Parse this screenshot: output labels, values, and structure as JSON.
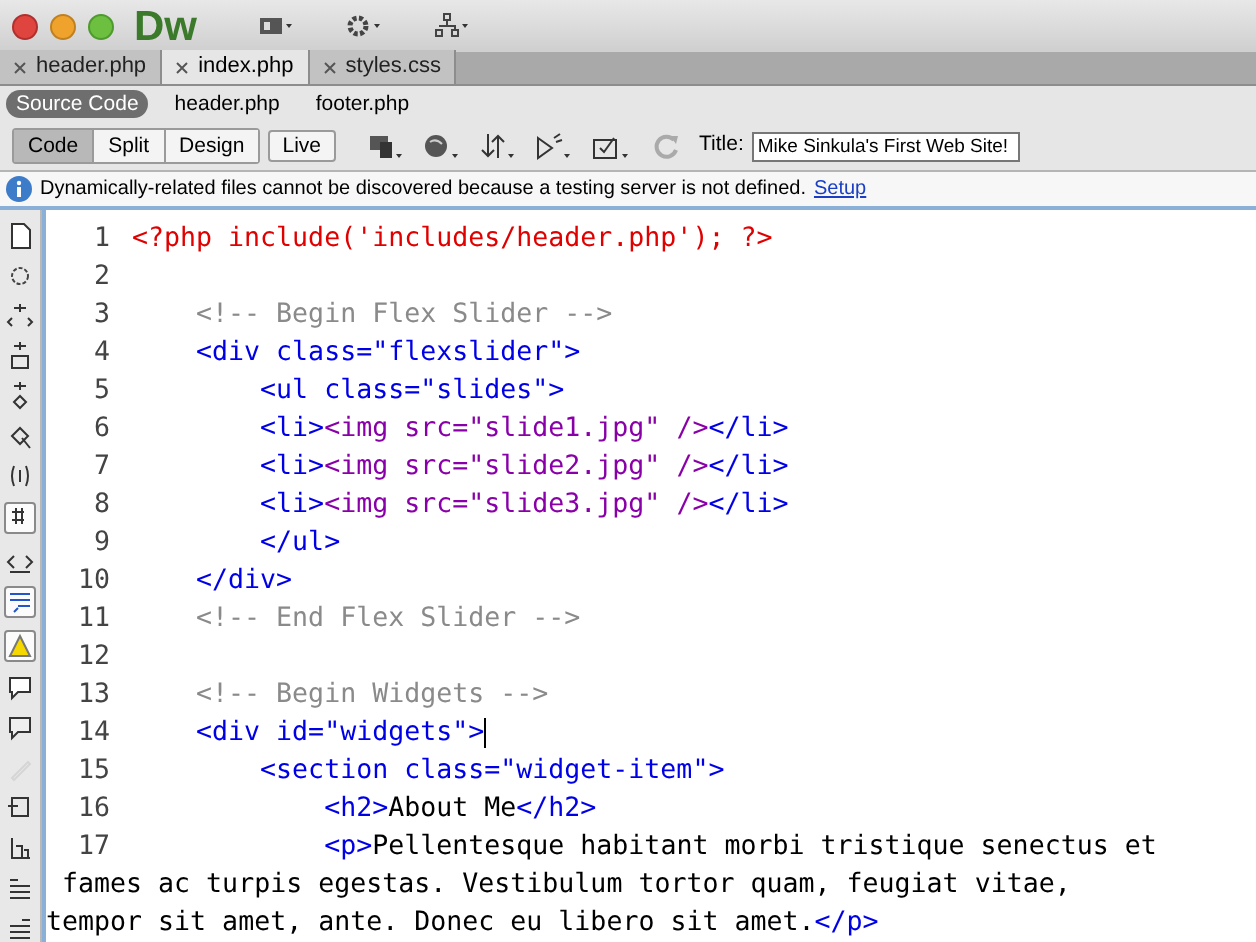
{
  "app": {
    "logo": "Dw"
  },
  "tabs": [
    {
      "label": "header.php",
      "selected": false
    },
    {
      "label": "index.php",
      "selected": true
    },
    {
      "label": "styles.css",
      "selected": false
    }
  ],
  "related_files": [
    {
      "label": "Source Code",
      "selected": true
    },
    {
      "label": "header.php",
      "selected": false
    },
    {
      "label": "footer.php",
      "selected": false
    }
  ],
  "view_buttons": [
    {
      "label": "Code",
      "selected": true
    },
    {
      "label": "Split",
      "selected": false
    },
    {
      "label": "Design",
      "selected": false
    }
  ],
  "live_button": {
    "label": "Live",
    "selected": false
  },
  "title_field": {
    "label": "Title:",
    "value": "Mike Sinkula's First Web Site!"
  },
  "info_bar": {
    "message": "Dynamically-related files cannot be discovered because a testing server is not defined.",
    "link": "Setup"
  },
  "side_tools": [
    {
      "on": false,
      "disabled": false
    },
    {
      "on": false,
      "disabled": false
    },
    {
      "on": false,
      "disabled": false
    },
    {
      "on": false,
      "disabled": false
    },
    {
      "on": false,
      "disabled": false
    },
    {
      "on": false,
      "disabled": false
    },
    {
      "on": false,
      "disabled": false
    },
    {
      "on": true,
      "disabled": false
    },
    {
      "on": false,
      "disabled": false
    },
    {
      "on": true,
      "disabled": false
    },
    {
      "on": true,
      "disabled": false
    },
    {
      "on": false,
      "disabled": false
    },
    {
      "on": false,
      "disabled": false
    },
    {
      "on": false,
      "disabled": true
    },
    {
      "on": false,
      "disabled": false
    },
    {
      "on": false,
      "disabled": false
    },
    {
      "on": false,
      "disabled": false
    },
    {
      "on": false,
      "disabled": false
    }
  ],
  "code_lines": [
    {
      "number": "1",
      "rows": [
        [
          {
            "kind": "php",
            "text": "<?php include('includes/header.php'); ?>"
          }
        ]
      ]
    },
    {
      "number": "2",
      "rows": [
        []
      ]
    },
    {
      "number": "3",
      "rows": [
        [
          {
            "kind": "comment",
            "text": "    <!-- Begin Flex Slider -->"
          }
        ]
      ]
    },
    {
      "number": "4",
      "rows": [
        [
          {
            "kind": "tag",
            "text": "    <div class=\"flexslider\">"
          }
        ]
      ]
    },
    {
      "number": "5",
      "rows": [
        [
          {
            "kind": "tag",
            "text": "        <ul class=\"slides\">"
          }
        ]
      ]
    },
    {
      "number": "6",
      "rows": [
        [
          {
            "kind": "tag",
            "text": "        <li>"
          },
          {
            "kind": "img",
            "text": "<img src=\"slide1.jpg\" />"
          },
          {
            "kind": "tag",
            "text": "</li>"
          }
        ]
      ]
    },
    {
      "number": "7",
      "rows": [
        [
          {
            "kind": "tag",
            "text": "        <li>"
          },
          {
            "kind": "img",
            "text": "<img src=\"slide2.jpg\" />"
          },
          {
            "kind": "tag",
            "text": "</li>"
          }
        ]
      ]
    },
    {
      "number": "8",
      "rows": [
        [
          {
            "kind": "tag",
            "text": "        <li>"
          },
          {
            "kind": "img",
            "text": "<img src=\"slide3.jpg\" />"
          },
          {
            "kind": "tag",
            "text": "</li>"
          }
        ]
      ]
    },
    {
      "number": "9",
      "rows": [
        [
          {
            "kind": "tag",
            "text": "        </ul>"
          }
        ]
      ]
    },
    {
      "number": "10",
      "rows": [
        [
          {
            "kind": "tag",
            "text": "    </div>"
          }
        ]
      ]
    },
    {
      "number": "11",
      "rows": [
        [
          {
            "kind": "comment",
            "text": "    <!-- End Flex Slider -->"
          }
        ]
      ]
    },
    {
      "number": "12",
      "rows": [
        []
      ]
    },
    {
      "number": "13",
      "rows": [
        [
          {
            "kind": "comment",
            "text": "    <!-- Begin Widgets -->"
          }
        ]
      ]
    },
    {
      "number": "14",
      "rows": [
        [
          {
            "kind": "tag",
            "text": "    <div id=\"widgets\">"
          }
        ]
      ],
      "caret": true
    },
    {
      "number": "15",
      "rows": [
        [
          {
            "kind": "tag",
            "text": "        <section class=\"widget-item\">"
          }
        ]
      ]
    },
    {
      "number": "16",
      "rows": [
        [
          {
            "kind": "tag",
            "text": "            <h2>"
          },
          {
            "kind": "text",
            "text": "About Me"
          },
          {
            "kind": "tag",
            "text": "</h2>"
          }
        ]
      ]
    },
    {
      "number": "17",
      "rows": [
        [
          {
            "kind": "tag",
            "text": "            <p>"
          },
          {
            "kind": "text",
            "text": "Pellentesque habitant morbi tristique senectus et"
          }
        ],
        [
          {
            "kind": "text",
            "text": " fames ac turpis egestas. Vestibulum tortor quam, feugiat vitae,"
          }
        ],
        [
          {
            "kind": "text",
            "text": "tempor sit amet, ante. Donec eu libero sit amet."
          },
          {
            "kind": "tag",
            "text": "</p>"
          }
        ]
      ]
    }
  ]
}
